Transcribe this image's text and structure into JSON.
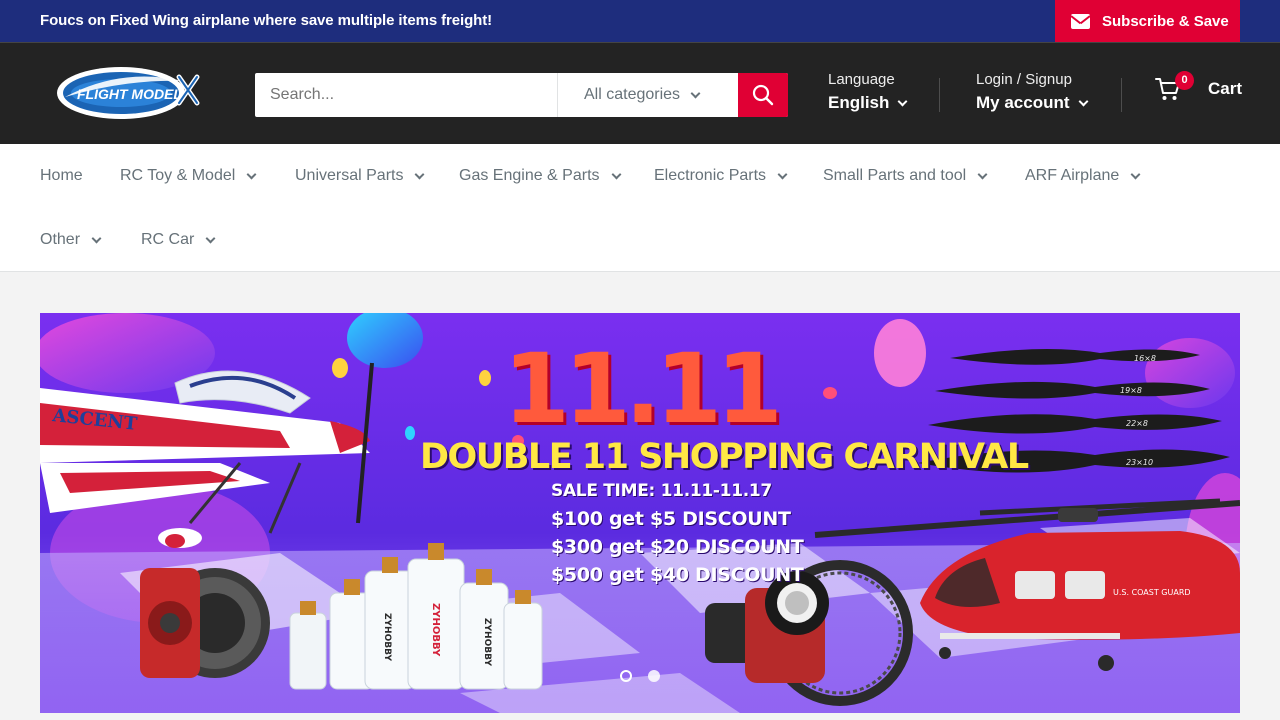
{
  "announcement": {
    "text": "Foucs on Fixed Wing airplane where save multiple items freight!",
    "subscribe_label": "Subscribe & Save"
  },
  "header": {
    "logo_text": "FLIGHT MODEL",
    "search": {
      "placeholder": "Search...",
      "category_label": "All categories"
    },
    "language": {
      "small": "Language",
      "value": "English"
    },
    "account": {
      "small": "Login / Signup",
      "value": "My account"
    },
    "cart": {
      "count": "0",
      "label": "Cart"
    }
  },
  "nav": {
    "items": [
      {
        "label": "Home"
      },
      {
        "label": "RC Toy & Model"
      },
      {
        "label": "Universal Parts"
      },
      {
        "label": "Gas Engine & Parts"
      },
      {
        "label": "Electronic Parts"
      },
      {
        "label": "Small Parts and tool"
      },
      {
        "label": "ARF Airplane"
      },
      {
        "label": "Other"
      },
      {
        "label": "RC Car"
      }
    ]
  },
  "banner": {
    "big_number": "11.11",
    "headline": "DOUBLE 11 SHOPPING CARNIVAL",
    "sale_time": "SALE TIME: 11.11-11.17",
    "offers": [
      "$100 get $5 DISCOUNT",
      "$300 get $20 DISCOUNT",
      "$500 get $40 DISCOUNT"
    ],
    "plane_label": "ASCENT",
    "bottle_brand": "ZYHOBBY",
    "prop_sizes": [
      "16×8",
      "19×8",
      "22×8",
      "23×10"
    ],
    "heli_label": "U.S. COAST GUARD",
    "slides": 2
  },
  "colors": {
    "announcement_bg": "#1e2d7d",
    "accent": "#e00034",
    "header_bg": "#232323",
    "nav_text": "#677279",
    "banner_bg": "#6a2ee8",
    "headline_yellow": "#ffe844"
  }
}
